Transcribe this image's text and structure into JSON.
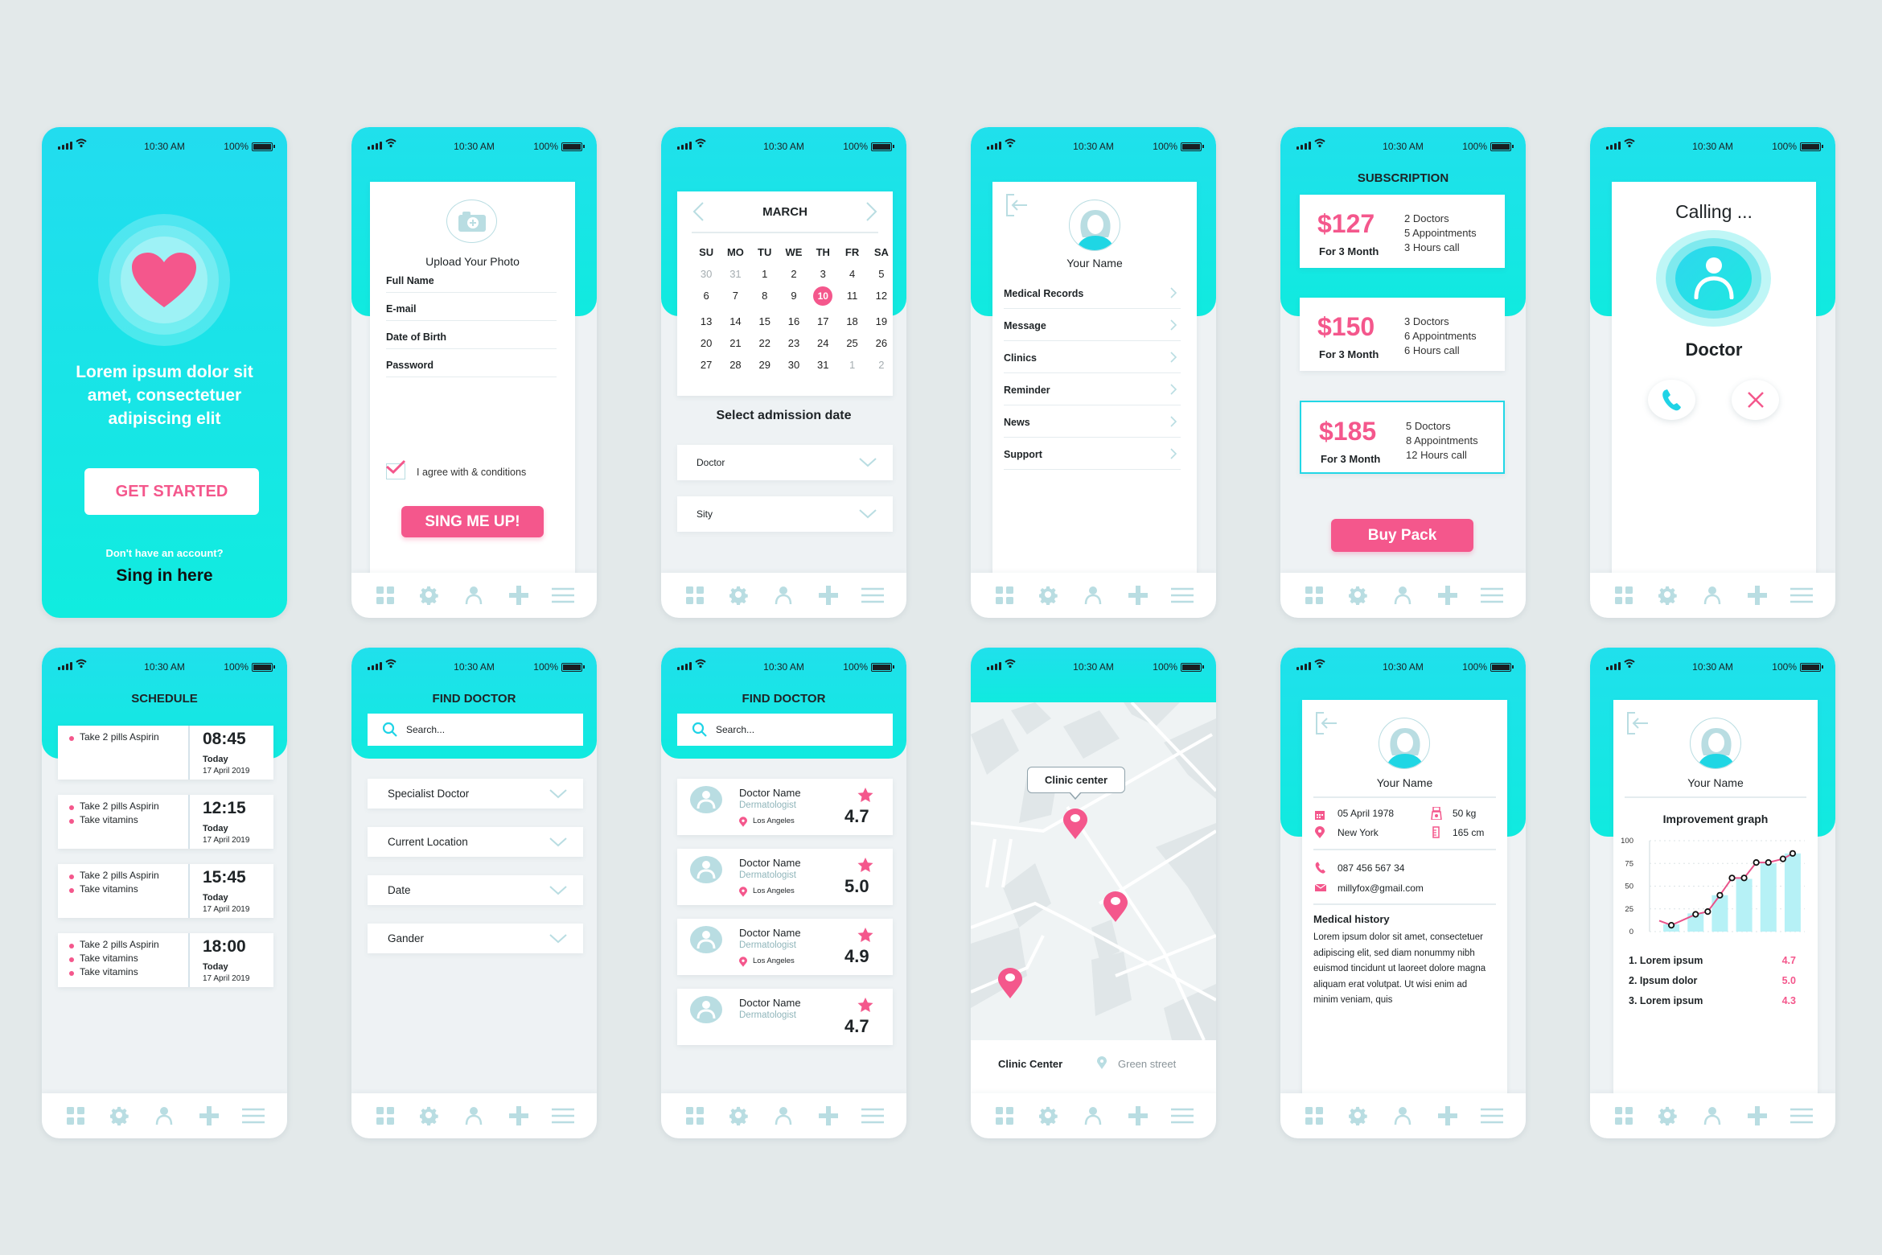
{
  "status_bar": {
    "time": "10:30 AM",
    "battery": "100%"
  },
  "nav_icons": [
    "grid-icon",
    "gear-icon",
    "user-icon",
    "plus-icon",
    "menu-icon"
  ],
  "colors": {
    "accent": "#1ee6e8",
    "pink": "#f4578c",
    "background": "#e3e9ea",
    "icon_muted": "#b9dde2"
  },
  "welcome": {
    "headline": "Lorem ipsum dolor sit amet, consectetuer adipiscing elit",
    "cta": "GET STARTED",
    "prompt": "Don't have an account?",
    "signin": "Sing in here"
  },
  "signup": {
    "upload_label": "Upload Your Photo",
    "fields": [
      "Full Name",
      "E-mail",
      "Date of Birth",
      "Password"
    ],
    "agree_label": "I agree with & conditions",
    "agree_checked": true,
    "submit": "SING ME UP!"
  },
  "calendar": {
    "month": "MARCH",
    "weekdays": [
      "SU",
      "MO",
      "TU",
      "WE",
      "TH",
      "FR",
      "SA"
    ],
    "weeks": [
      [
        "30",
        "31",
        "1",
        "2",
        "3",
        "4",
        "5"
      ],
      [
        "6",
        "7",
        "8",
        "9",
        "10",
        "11",
        "12"
      ],
      [
        "13",
        "14",
        "15",
        "16",
        "17",
        "18",
        "19"
      ],
      [
        "20",
        "21",
        "22",
        "23",
        "24",
        "25",
        "26"
      ],
      [
        "27",
        "28",
        "29",
        "30",
        "31",
        "1",
        "2"
      ]
    ],
    "selected": "10",
    "subtitle": "Select admission date",
    "dropdowns": [
      "Doctor",
      "Sity"
    ]
  },
  "menu": {
    "name": "Your Name",
    "items": [
      "Medical Records",
      "Message",
      "Clinics",
      "Reminder",
      "News",
      "Support"
    ]
  },
  "subscription": {
    "title": "SUBSCRIPTION",
    "plans": [
      {
        "price": "$127",
        "period": "For 3 Month",
        "features": [
          "2 Doctors",
          "5 Appointments",
          "3 Hours call"
        ],
        "selected": false
      },
      {
        "price": "$150",
        "period": "For 3 Month",
        "features": [
          "3 Doctors",
          "6 Appointments",
          "6 Hours call"
        ],
        "selected": false
      },
      {
        "price": "$185",
        "period": "For 3 Month",
        "features": [
          "5 Doctors",
          "8 Appointments",
          "12 Hours call"
        ],
        "selected": true
      }
    ],
    "buy": "Buy Pack"
  },
  "calling": {
    "status": "Calling ...",
    "callee": "Doctor"
  },
  "schedule": {
    "title": "SCHEDULE",
    "entries": [
      {
        "tasks": [
          "Take 2 pills Aspirin"
        ],
        "time": "08:45",
        "day": "Today",
        "date": "17 April 2019"
      },
      {
        "tasks": [
          "Take 2 pills Aspirin",
          "Take vitamins"
        ],
        "time": "12:15",
        "day": "Today",
        "date": "17 April 2019"
      },
      {
        "tasks": [
          "Take 2 pills Aspirin",
          "Take vitamins"
        ],
        "time": "15:45",
        "day": "Today",
        "date": "17 April 2019"
      },
      {
        "tasks": [
          "Take 2 pills Aspirin",
          "Take vitamins",
          "Take vitamins"
        ],
        "time": "18:00",
        "day": "Today",
        "date": "17 April 2019"
      }
    ]
  },
  "find_filters": {
    "title": "FIND DOCTOR",
    "search_placeholder": "Search...",
    "filters": [
      "Specialist Doctor",
      "Current Location",
      "Date",
      "Gander"
    ]
  },
  "find_results": {
    "title": "FIND DOCTOR",
    "search_placeholder": "Search...",
    "doctors": [
      {
        "name": "Doctor Name",
        "specialty": "Dermatologist",
        "location": "Los Angeles",
        "rating": "4.7"
      },
      {
        "name": "Doctor Name",
        "specialty": "Dermatologist",
        "location": "Los Angeles",
        "rating": "5.0"
      },
      {
        "name": "Doctor Name",
        "specialty": "Dermatologist",
        "location": "Los Angeles",
        "rating": "4.9"
      },
      {
        "name": "Doctor Name",
        "specialty": "Dermatologist",
        "location": "",
        "rating": "4.7"
      }
    ]
  },
  "map": {
    "callout": "Clinic center",
    "place": "Clinic Center",
    "street": "Green street"
  },
  "profile": {
    "name": "Your Name",
    "dob": "05 April 1978",
    "weight": "50 kg",
    "city": "New York",
    "height": "165 cm",
    "phone": "087 456 567 34",
    "email": "millyfox@gmail.com",
    "history_title": "Medical history",
    "history_text": "Lorem ipsum dolor sit amet, consectetuer adipiscing elit, sed diam nonummy nibh euismod tincidunt ut laoreet dolore magna aliquam erat volutpat. Ut wisi enim ad minim veniam, quis"
  },
  "improvement": {
    "name": "Your Name",
    "ranking": [
      {
        "label": "1. Lorem ipsum",
        "value": "4.7"
      },
      {
        "label": "2. Ipsum dolor",
        "value": "5.0"
      },
      {
        "label": "3. Lorem ipsum",
        "value": "4.3"
      }
    ]
  },
  "chart_data": {
    "type": "bar",
    "title": "Improvement graph",
    "xlabel": "",
    "ylabel": "",
    "ylim": [
      0,
      100
    ],
    "yticks": [
      "0",
      "25",
      "50",
      "75",
      "100"
    ],
    "grid": true,
    "series": [
      {
        "name": "bars",
        "type": "bar",
        "values": [
          8,
          20,
          40,
          58,
          75,
          86
        ]
      },
      {
        "name": "line",
        "type": "line",
        "x": [
          -0.5,
          0,
          1,
          1.5,
          2,
          2.5,
          3,
          3.5,
          4,
          4.6,
          5
        ],
        "values": [
          12,
          7,
          19,
          22,
          40,
          59,
          59,
          76,
          76,
          80,
          86
        ]
      }
    ]
  }
}
